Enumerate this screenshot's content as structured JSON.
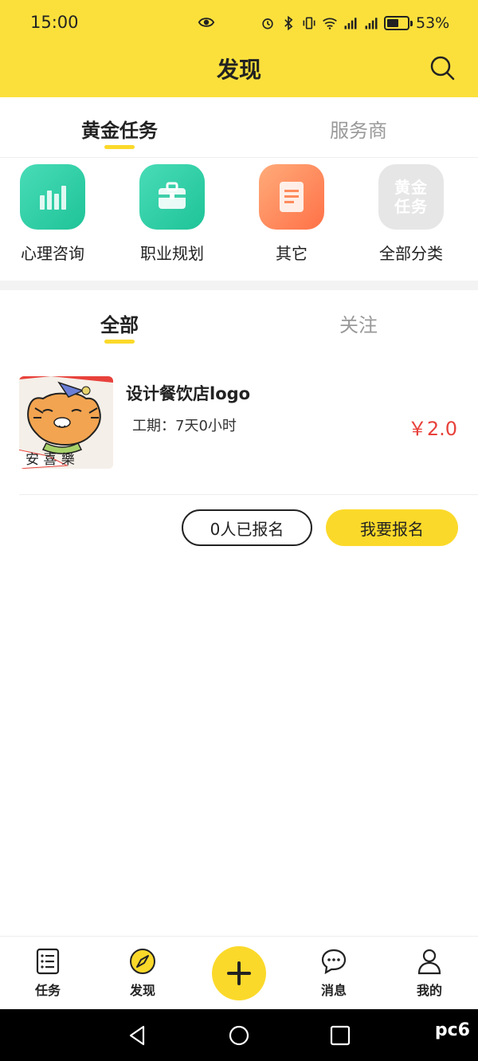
{
  "status_bar": {
    "time": "15:00",
    "battery": "53%"
  },
  "header": {
    "title": "发现"
  },
  "main_tabs": [
    {
      "label": "黄金任务",
      "active": true
    },
    {
      "label": "服务商",
      "active": false
    }
  ],
  "categories": [
    {
      "label": "心理咨询",
      "icon": "bar-chart-icon",
      "color": "#2fd0a8"
    },
    {
      "label": "职业规划",
      "icon": "briefcase-icon",
      "color": "#2fd0a8"
    },
    {
      "label": "其它",
      "icon": "document-icon",
      "color": "#ff8a5c"
    },
    {
      "label": "全部分类",
      "icon_text": "黄金任务",
      "color": "#e6e6e6"
    }
  ],
  "sub_tabs": [
    {
      "label": "全部",
      "active": true
    },
    {
      "label": "关注",
      "active": false
    }
  ],
  "task": {
    "title": "设计餐饮店logo",
    "period": "工期：7天0小时",
    "price": "￥2.0",
    "signup_count": "0人已报名",
    "signup_button": "我要报名"
  },
  "bottom_nav": [
    {
      "label": "任务",
      "icon": "list-icon"
    },
    {
      "label": "发现",
      "icon": "compass-icon"
    },
    {
      "label": "",
      "icon": "add-icon"
    },
    {
      "label": "消息",
      "icon": "chat-icon"
    },
    {
      "label": "我的",
      "icon": "user-icon"
    }
  ],
  "watermark": "pc6",
  "colors": {
    "accent": "#fbd92a",
    "header": "#fbe03c",
    "price": "#e8413b",
    "teal": "#2fd0a8",
    "orange": "#ff8a5c"
  }
}
